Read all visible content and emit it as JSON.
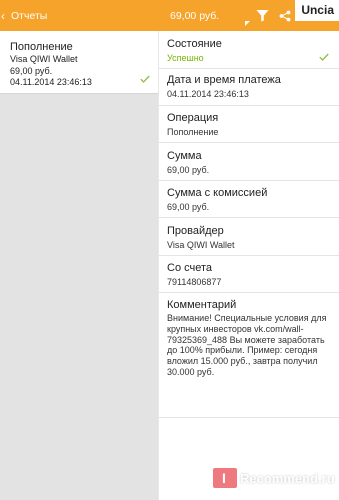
{
  "actionbar": {
    "back_arrow": "‹",
    "title": "Отчеты",
    "amount": "69,00 руб.",
    "icons": [
      "dropdown-triangle",
      "filter-icon",
      "share-icon"
    ],
    "color": "#f5a32a"
  },
  "watermark": "Uncia",
  "operation_item": {
    "title": "Пополнение",
    "provider": "Visa QIWI Wallet",
    "amount": "69,00 руб.",
    "datetime": "04.11.2014 23:46:13"
  },
  "details": {
    "status_label": "Состояние",
    "status_value": "Успешно",
    "status_color": "#77b300",
    "datetime_label": "Дата и время платежа",
    "datetime_value": "04.11.2014 23:46:13",
    "operation_label": "Операция",
    "operation_value": "Пополнение",
    "sum_label": "Сумма",
    "sum_value": "69,00 руб.",
    "sum_commission_label": "Сумма с комиссией",
    "sum_commission_value": "69,00 руб.",
    "provider_label": "Провайдер",
    "provider_value": "Visa QIWI Wallet",
    "account_label": "Со счета",
    "account_value": "79114806877",
    "comment_label": "Комментарий",
    "comment_value": "Внимание! Специальные условия для крупных инвесторов vk.com/wall-79325369_488 Вы можете заработать до 100% прибыли. Пример: сегодня вложил 15.000 руб., завтра получил 30.000 руб."
  },
  "site_logo": {
    "letter": "I",
    "text": "Recommend.ru"
  }
}
